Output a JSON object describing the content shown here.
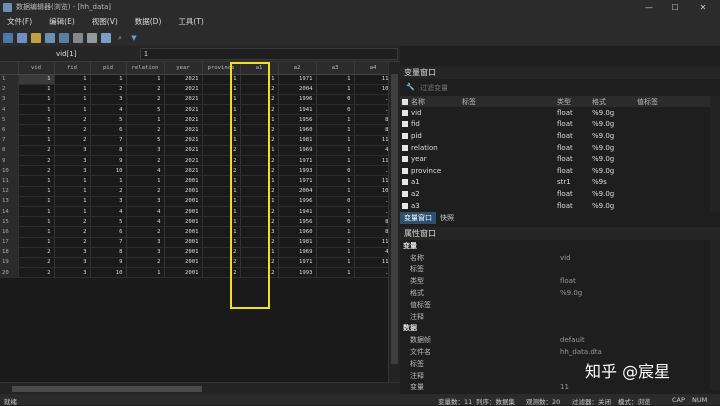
{
  "window": {
    "title": "数据编辑器(浏览) - [hh_data]",
    "minimize": "—",
    "maximize": "☐",
    "close": "✕"
  },
  "menu": [
    "文件(F)",
    "编辑(E)",
    "视图(V)",
    "数据(D)",
    "工具(T)"
  ],
  "command": {
    "label": "vid[1]",
    "value": "1"
  },
  "grid": {
    "columns": [
      "vid",
      "fid",
      "pid",
      "relation",
      "year",
      "province",
      "a1",
      "a2",
      "a3",
      "a4"
    ],
    "rows": [
      [
        "1",
        "1",
        "1",
        "1",
        "1",
        "2021",
        "1",
        "1",
        "1971",
        "1",
        "11"
      ],
      [
        "2",
        "1",
        "1",
        "2",
        "2",
        "2021",
        "1",
        "2",
        "2004",
        "1",
        "10"
      ],
      [
        "3",
        "1",
        "1",
        "3",
        "2",
        "2021",
        "1",
        "2",
        "1996",
        "0",
        "."
      ],
      [
        "4",
        "1",
        "1",
        "4",
        "5",
        "2021",
        "1",
        "2",
        "1941",
        "0",
        "."
      ],
      [
        "5",
        "1",
        "2",
        "5",
        "1",
        "2021",
        "1",
        "1",
        "1956",
        "1",
        "8"
      ],
      [
        "6",
        "1",
        "2",
        "6",
        "2",
        "2021",
        "1",
        "2",
        "1960",
        "1",
        "8"
      ],
      [
        "7",
        "1",
        "2",
        "7",
        "5",
        "2021",
        "1",
        "2",
        "1981",
        "1",
        "11"
      ],
      [
        "8",
        "2",
        "3",
        "8",
        "3",
        "2021",
        "2",
        "1",
        "1969",
        "1",
        "4"
      ],
      [
        "9",
        "2",
        "3",
        "9",
        "2",
        "2021",
        "2",
        "2",
        "1971",
        "1",
        "11"
      ],
      [
        "10",
        "2",
        "3",
        "10",
        "4",
        "2021",
        "2",
        "2",
        "1993",
        "0",
        "."
      ],
      [
        "11",
        "1",
        "1",
        "1",
        "1",
        "2001",
        "1",
        "1",
        "1971",
        "1",
        "11"
      ],
      [
        "12",
        "1",
        "1",
        "2",
        "2",
        "2001",
        "1",
        "2",
        "2004",
        "1",
        "10"
      ],
      [
        "13",
        "1",
        "1",
        "3",
        "3",
        "2001",
        "1",
        "1",
        "1996",
        "0",
        "."
      ],
      [
        "14",
        "1",
        "1",
        "4",
        "4",
        "2001",
        "1",
        "2",
        "1941",
        "1",
        "."
      ],
      [
        "15",
        "1",
        "2",
        "5",
        "4",
        "2001",
        "1",
        "2",
        "1956",
        "0",
        "8"
      ],
      [
        "16",
        "1",
        "2",
        "6",
        "2",
        "2001",
        "1",
        "3",
        "1960",
        "1",
        "8"
      ],
      [
        "17",
        "1",
        "2",
        "7",
        "3",
        "2001",
        "1",
        "2",
        "1981",
        "1",
        "11"
      ],
      [
        "18",
        "2",
        "3",
        "8",
        "3",
        "2001",
        "2",
        "1",
        "1969",
        "1",
        "4"
      ],
      [
        "19",
        "2",
        "3",
        "9",
        "2",
        "2001",
        "2",
        "2",
        "1971",
        "1",
        "11"
      ],
      [
        "20",
        "2",
        "3",
        "10",
        "1",
        "2001",
        "2",
        "2",
        "1993",
        "1",
        "."
      ]
    ]
  },
  "variables_panel": {
    "title": "变量窗口",
    "filter_placeholder": "过滤变量",
    "headers": [
      "名称",
      "标签",
      "类型",
      "格式",
      "值标签"
    ],
    "items": [
      {
        "name": "vid",
        "type": "float",
        "format": "%9.0g"
      },
      {
        "name": "fid",
        "type": "float",
        "format": "%9.0g"
      },
      {
        "name": "pid",
        "type": "float",
        "format": "%9.0g"
      },
      {
        "name": "relation",
        "type": "float",
        "format": "%9.0g"
      },
      {
        "name": "year",
        "type": "float",
        "format": "%9.0g"
      },
      {
        "name": "province",
        "type": "float",
        "format": "%9.0g"
      },
      {
        "name": "a1",
        "type": "str1",
        "format": "%9s"
      },
      {
        "name": "a2",
        "type": "float",
        "format": "%9.0g"
      },
      {
        "name": "a3",
        "type": "float",
        "format": "%9.0g"
      }
    ],
    "tabs": [
      "变量窗口",
      "快照"
    ]
  },
  "properties_panel": {
    "title": "属性窗口",
    "rows": [
      {
        "key": "变量",
        "value": "",
        "section": true
      },
      {
        "key": "名称",
        "value": "vid"
      },
      {
        "key": "标签",
        "value": ""
      },
      {
        "key": "类型",
        "value": "float"
      },
      {
        "key": "格式",
        "value": "%9.0g"
      },
      {
        "key": "值标签",
        "value": ""
      },
      {
        "key": "注释",
        "value": ""
      },
      {
        "key": "数据",
        "value": "",
        "section": true
      },
      {
        "key": "数据帧",
        "value": "default"
      },
      {
        "key": "文件名",
        "value": "hh_data.dta"
      },
      {
        "key": "标签",
        "value": ""
      },
      {
        "key": "注释",
        "value": ""
      },
      {
        "key": "变量",
        "value": "11"
      }
    ]
  },
  "status": {
    "left": "就绪",
    "vars": "变量数：11",
    "order": "列序：数据集",
    "obs": "观测数：20",
    "filter": "过滤器：关闭",
    "mode": "模式：浏览",
    "cap": "CAP",
    "num": "NUM"
  },
  "watermark": "知乎 @宸星"
}
